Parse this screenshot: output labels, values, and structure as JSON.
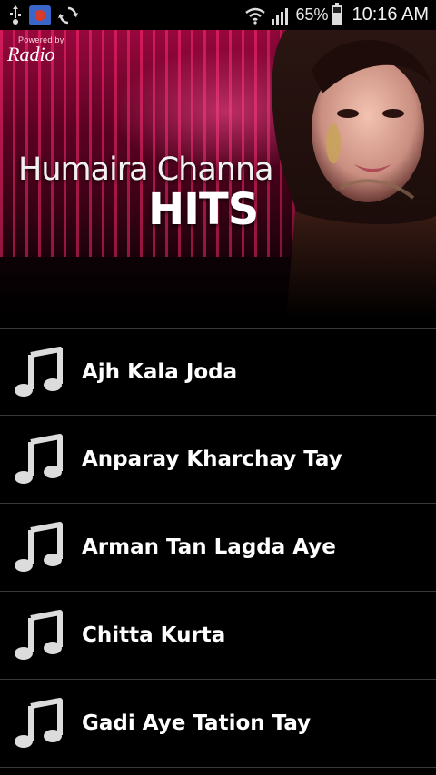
{
  "status_bar": {
    "battery_percent": "65%",
    "battery_level": 0.65,
    "time": "10:16 AM",
    "icons": [
      "usb-icon",
      "app-notification-icon",
      "sync-icon",
      "wifi-icon",
      "signal-icon",
      "battery-charging-icon"
    ]
  },
  "banner": {
    "powered_by": "Powered by",
    "radio_logo": "Radio",
    "title_line1": "Humaira Channa",
    "title_line2": "HITS"
  },
  "songs": [
    {
      "title": "Ajh Kala Joda",
      "icon": "music-note-icon"
    },
    {
      "title": "Anparay Kharchay Tay",
      "icon": "music-note-icon"
    },
    {
      "title": "Arman Tan Lagda Aye",
      "icon": "music-note-icon"
    },
    {
      "title": "Chitta Kurta",
      "icon": "music-note-icon"
    },
    {
      "title": "Gadi Aye Tation Tay",
      "icon": "music-note-icon"
    }
  ],
  "colors": {
    "background": "#000000",
    "stripe_accent": "#ff2870",
    "divider": "#3a3a3a",
    "icon": "#dcdcdc"
  }
}
